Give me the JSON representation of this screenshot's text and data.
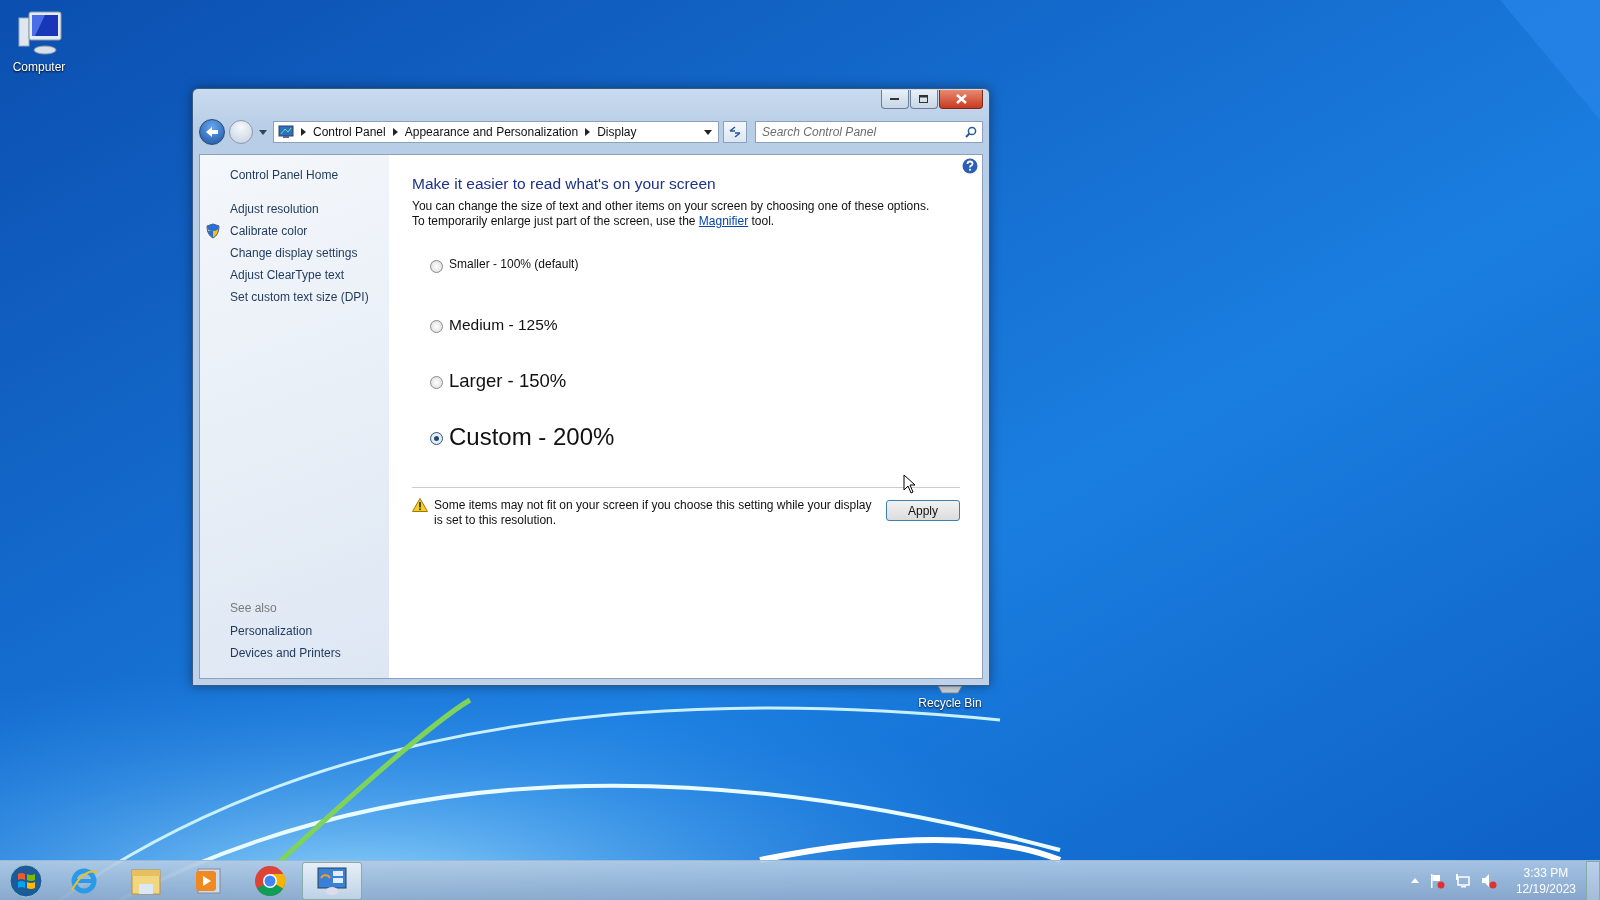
{
  "desktop_icons": [
    {
      "kind": "computer",
      "label": "Computer"
    },
    {
      "kind": "recycle",
      "label": "Recycle Bin"
    }
  ],
  "window": {
    "breadcrumbs": [
      "Control Panel",
      "Appearance and Personalization",
      "Display"
    ],
    "search": {
      "placeholder": "Search Control Panel"
    },
    "sidebar": {
      "home": "Control Panel Home",
      "tasks": [
        {
          "label": "Adjust resolution",
          "shield": false
        },
        {
          "label": "Calibrate color",
          "shield": true
        },
        {
          "label": "Change display settings",
          "shield": false
        },
        {
          "label": "Adjust ClearType text",
          "shield": false
        },
        {
          "label": "Set custom text size (DPI)",
          "shield": false
        }
      ],
      "see_also_heading": "See also",
      "see_also": [
        "Personalization",
        "Devices and Printers"
      ]
    },
    "main": {
      "heading": "Make it easier to read what's on your screen",
      "description_before": "You can change the size of text and other items on your screen by choosing one of these options. To temporarily enlarge just part of the screen, use the",
      "description_link": "Magnifier",
      "description_after": "tool.",
      "options": [
        {
          "label": "Smaller - 100% (default)",
          "selected": false
        },
        {
          "label": "Medium - 125%",
          "selected": false
        },
        {
          "label": "Larger - 150%",
          "selected": false
        },
        {
          "label": "Custom - 200%",
          "selected": true
        }
      ],
      "warning": "Some items may not fit on your screen if you choose this setting while your display is set to this resolution.",
      "apply": "Apply"
    }
  },
  "taskbar": {
    "apps": [
      {
        "kind": "ie",
        "active": false
      },
      {
        "kind": "explorer",
        "active": false
      },
      {
        "kind": "media",
        "active": false
      },
      {
        "kind": "chrome",
        "active": false
      },
      {
        "kind": "control-panel",
        "active": true
      }
    ],
    "time": "3:33 PM",
    "date": "12/19/2023"
  }
}
